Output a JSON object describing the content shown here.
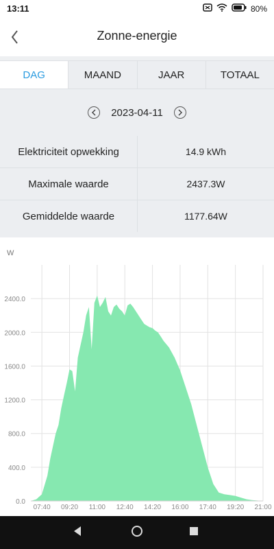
{
  "status": {
    "time": "13:11",
    "battery_text": "80%"
  },
  "header": {
    "title": "Zonne-energie",
    "back_icon": "chevron-left-icon"
  },
  "tabs": [
    {
      "label": "DAG",
      "active": true
    },
    {
      "label": "MAAND",
      "active": false
    },
    {
      "label": "JAAR",
      "active": false
    },
    {
      "label": "TOTAAL",
      "active": false
    }
  ],
  "date_nav": {
    "date": "2023-04-11"
  },
  "stats": [
    {
      "label": "Elektriciteit opwekking",
      "value": "14.9 kWh"
    },
    {
      "label": "Maximale waarde",
      "value": "2437.3W"
    },
    {
      "label": "Gemiddelde waarde",
      "value": "1177.64W"
    }
  ],
  "colors": {
    "accent": "#2a9be0",
    "area_fill": "#86e8b0"
  },
  "chart_data": {
    "type": "area",
    "ylabel": "W",
    "ylim": [
      0,
      2800
    ],
    "y_ticks": [
      "0.0",
      "400.0",
      "800.0",
      "1200.0",
      "1600.0",
      "2000.0",
      "2400.0"
    ],
    "x_ticks": [
      "07:40",
      "09:20",
      "11:00",
      "12:40",
      "14:20",
      "16:00",
      "17:40",
      "19:20",
      "21:00"
    ],
    "x": [
      "07:00",
      "07:20",
      "07:40",
      "08:00",
      "08:10",
      "08:20",
      "08:30",
      "08:40",
      "08:50",
      "09:00",
      "09:10",
      "09:20",
      "09:30",
      "09:40",
      "09:50",
      "10:00",
      "10:10",
      "10:20",
      "10:30",
      "10:40",
      "10:50",
      "11:00",
      "11:10",
      "11:20",
      "11:30",
      "11:40",
      "11:50",
      "12:00",
      "12:10",
      "12:20",
      "12:30",
      "12:40",
      "12:50",
      "13:00",
      "13:10",
      "13:20",
      "13:30",
      "13:40",
      "13:50",
      "14:00",
      "14:10",
      "14:20",
      "14:30",
      "14:40",
      "14:50",
      "15:00",
      "15:20",
      "15:40",
      "16:00",
      "16:20",
      "16:40",
      "17:00",
      "17:20",
      "17:40",
      "18:00",
      "18:20",
      "18:40",
      "19:00",
      "19:20",
      "19:40",
      "20:00",
      "20:20",
      "20:40",
      "21:00"
    ],
    "series": [
      {
        "values": [
          0,
          20,
          80,
          300,
          500,
          650,
          800,
          900,
          1100,
          1250,
          1400,
          1560,
          1540,
          1300,
          1700,
          1850,
          2000,
          2200,
          2300,
          1800,
          2350,
          2437,
          2300,
          2350,
          2420,
          2250,
          2200,
          2300,
          2330,
          2280,
          2250,
          2200,
          2320,
          2340,
          2300,
          2250,
          2200,
          2150,
          2100,
          2080,
          2060,
          2050,
          2020,
          2000,
          1950,
          1900,
          1820,
          1700,
          1550,
          1350,
          1150,
          900,
          650,
          400,
          200,
          100,
          80,
          70,
          60,
          40,
          20,
          10,
          5,
          0
        ]
      }
    ]
  }
}
